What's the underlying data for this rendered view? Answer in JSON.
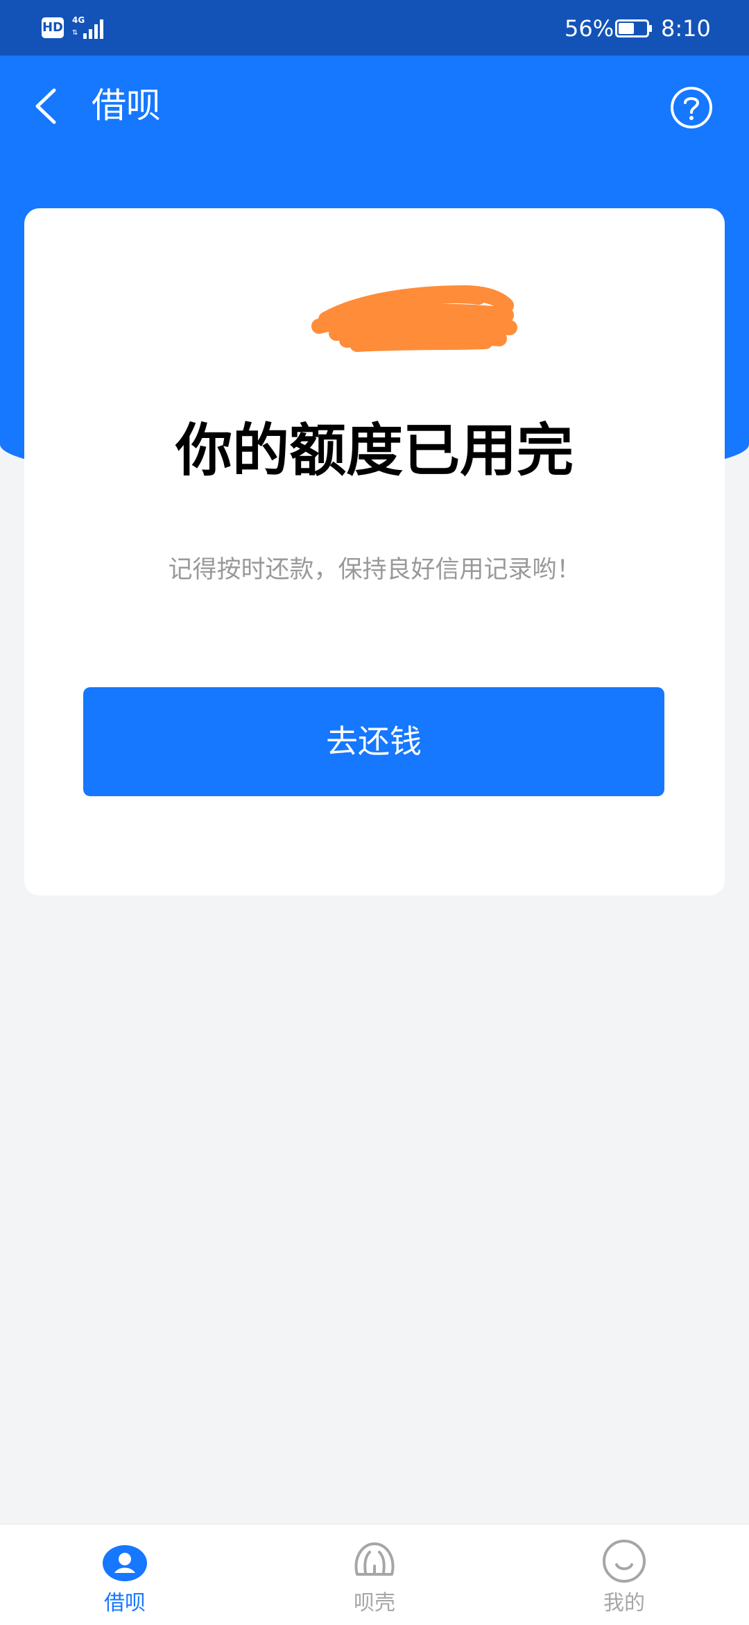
{
  "status_bar": {
    "network_badge": "HD",
    "battery_percent": "56%",
    "time": "8:10"
  },
  "header": {
    "title": "借呗",
    "back_icon": "chevron-left-icon",
    "help_icon": "question-circle-icon"
  },
  "card": {
    "title": "你的额度已用完",
    "subtitle": "记得按时还款，保持良好信用记录哟！",
    "button_label": "去还钱"
  },
  "tabs": [
    {
      "label": "借呗",
      "icon": "jiebei-icon",
      "active": true
    },
    {
      "label": "呗壳",
      "icon": "shell-icon",
      "active": false
    },
    {
      "label": "我的",
      "icon": "smile-icon",
      "active": false
    }
  ],
  "colors": {
    "status_bar": "#1353b8",
    "primary": "#1677ff",
    "page_background": "#f3f4f6",
    "scribble": "#ff8c38",
    "tab_inactive": "#a6a6a6"
  }
}
